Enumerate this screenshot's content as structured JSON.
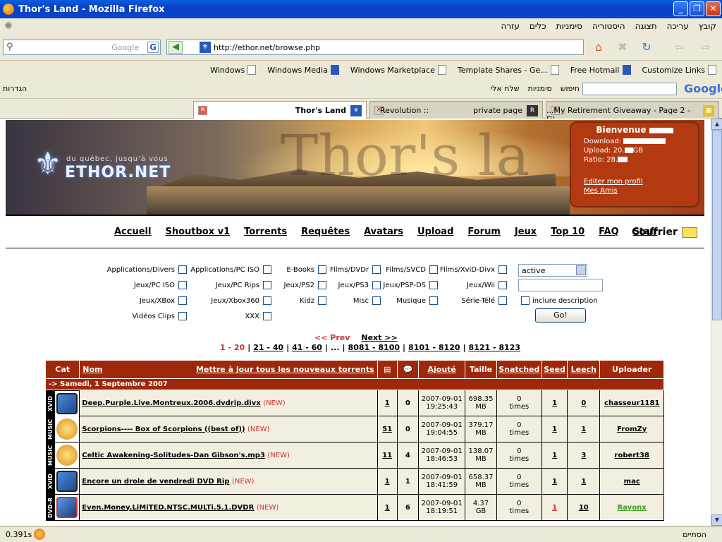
{
  "window": {
    "title": "Thor's Land - Mozilla Firefox"
  },
  "menu": {
    "items": [
      "קובץ",
      "עריכה",
      "תצוגה",
      "היסטוריה",
      "סימניות",
      "כלים",
      "עזרה"
    ]
  },
  "search": {
    "placeholder": "Google"
  },
  "address": {
    "url": "http://ethor.net/browse.php"
  },
  "bookmarks": [
    "Windows",
    "Windows Media",
    "Windows Marketplace",
    "Template Shares - Ge...",
    "Free Hotmail",
    "Customize Links"
  ],
  "hebrew_toolbar": {
    "settings": "הגדרות",
    "items": [
      "חיפוש",
      "סימניות",
      "שלח אלי"
    ],
    "google_logo": "Google"
  },
  "tabs": [
    {
      "label": "Thor's Land",
      "active": true
    },
    {
      "label": "Revolution ::                  private page",
      "active": false
    },
    {
      "label": "...My Retirement Giveaway - Page 2 - Fil",
      "active": false
    }
  ],
  "banner": {
    "logo": "ETHOR.NET",
    "tagline": "du québec, jusqu'à vous",
    "big_text": "Thor's la"
  },
  "welcome": {
    "title": "Bienvenue",
    "download_label": "Download:",
    "upload_label": "Upload: 20.",
    "upload_unit": "GB",
    "ratio_label": "Ratio: 28.",
    "edit_profile": "Editer mon profil",
    "friends": "Mes Amis"
  },
  "nav": {
    "links": [
      "Accueil",
      "Shoutbox v1",
      "Torrents",
      "Requêtes",
      "Avatars",
      "Upload",
      "Forum",
      "Jeux",
      "Top 10",
      "FAQ",
      "Staff"
    ],
    "courrier": "Courrier"
  },
  "categories": [
    "Applications/Divers",
    "Applications/PC ISO",
    "E-Books",
    "Films/DVDr",
    "Films/SVCD",
    "Films/XviD-Divx",
    "Jeux/PC ISO",
    "Jeux/PC Rips",
    "Jeux/PS2",
    "Jeux/PS3",
    "Jeux/PSP-DS",
    "Jeux/Wii",
    "Jeux/XBox",
    "Jeux/Xbox360",
    "Kidz",
    "Misc",
    "Musique",
    "Série-Télé",
    "Vidéos Clips",
    "XXX"
  ],
  "filter": {
    "status": "active",
    "include_desc": "inclure description",
    "go": "Go!"
  },
  "pager": {
    "prev": "<< Prev",
    "next": "Next >>",
    "pages": [
      "1 - 20",
      "21 - 40",
      "41 - 60",
      "...",
      "8081 - 8100",
      "8101 - 8120",
      "8121 - 8123"
    ]
  },
  "table": {
    "headers": {
      "cat": "Cat",
      "nom": "Nom",
      "update_all": "Mettre à jour tous les nouveaux torrents",
      "ajoute": "Ajouté",
      "taille": "Taille",
      "snatched": "Snatched",
      "seed": "Seed",
      "leech": "Leech",
      "uploader": "Uploader"
    },
    "day": "-> Samedi, 1 Septembre 2007",
    "rows": [
      {
        "cat": "XVID",
        "icon": "film",
        "name": "Deep.Purple.Live.Montreux.2006.dvdrip.divx",
        "new": "(NEW)",
        "files": "1",
        "comments": "0",
        "date": "2007-09-01",
        "time": "19:25:43",
        "size": "698.35",
        "unit": "MB",
        "snatched": "0",
        "times": "times",
        "seed": "1",
        "leech": "0",
        "uploader": "chasseur1181"
      },
      {
        "cat": "MUSIC",
        "icon": "music",
        "name": "Scorpions---- Box of Scorpions ((best of))",
        "new": "(NEW)",
        "files": "51",
        "comments": "0",
        "date": "2007-09-01",
        "time": "19:04:55",
        "size": "379.17",
        "unit": "MB",
        "snatched": "0",
        "times": "times",
        "seed": "1",
        "leech": "1",
        "uploader": "FromZy"
      },
      {
        "cat": "MUSIC",
        "icon": "music",
        "name": "Celtic Awakening-Solitudes-Dan Gibson's.mp3",
        "new": "(NEW)",
        "files": "11",
        "comments": "4",
        "date": "2007-09-01",
        "time": "18:46:53",
        "size": "138.07",
        "unit": "MB",
        "snatched": "0",
        "times": "times",
        "seed": "1",
        "leech": "3",
        "uploader": "robert38"
      },
      {
        "cat": "XVID",
        "icon": "film",
        "name": "Encore un drole de vendredi DVD Rip",
        "new": "(NEW)",
        "files": "1",
        "comments": "1",
        "date": "2007-09-01",
        "time": "18:41:59",
        "size": "658.37",
        "unit": "MB",
        "snatched": "0",
        "times": "times",
        "seed": "1",
        "leech": "1",
        "uploader": "mac"
      },
      {
        "cat": "DVD-R",
        "icon": "dvd",
        "name": "Even.Money.LiMiTED.NTSC.MULTi.5.1.DVDR",
        "new": "(NEW)",
        "files": "1",
        "comments": "6",
        "date": "2007-09-01",
        "time": "18:19:51",
        "size": "4.37",
        "unit": "GB",
        "snatched": "0",
        "times": "times",
        "seed": "1",
        "leech": "10",
        "uploader": "Rayonx"
      }
    ]
  },
  "status": {
    "time": "0.391s",
    "done": "הסתיים"
  }
}
